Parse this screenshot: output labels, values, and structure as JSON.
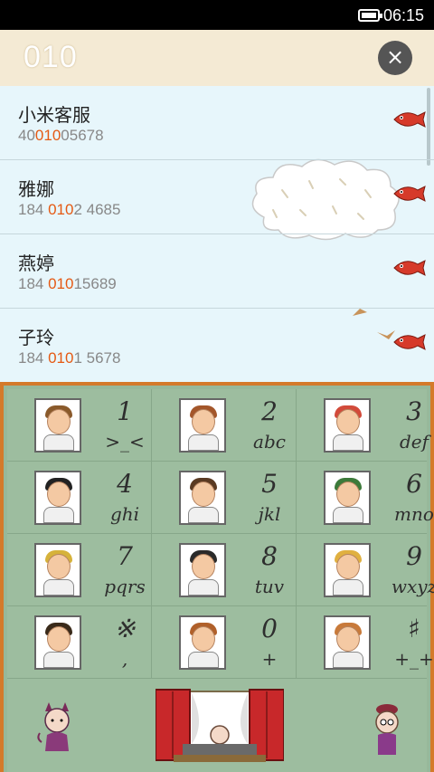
{
  "status_bar": {
    "time": "06:15"
  },
  "dialer": {
    "input_value": "010",
    "clear_icon": "close-circle-icon",
    "clear_label": "×"
  },
  "results": [
    {
      "name": "小米客服",
      "num_pre": "40",
      "num_hl": "010",
      "num_post": "05678"
    },
    {
      "name": "雅娜",
      "num_pre": "184 ",
      "num_hl": "010",
      "num_post": "2 4685"
    },
    {
      "name": "燕婷",
      "num_pre": "184 ",
      "num_hl": "010",
      "num_post": "15689"
    },
    {
      "name": "子玲",
      "num_pre": "184 ",
      "num_hl": "010",
      "num_post": "1 5678"
    }
  ],
  "keys": [
    {
      "digit": "1",
      "letters": ">_<"
    },
    {
      "digit": "2",
      "letters": "abc"
    },
    {
      "digit": "3",
      "letters": "def"
    },
    {
      "digit": "4",
      "letters": "ghi"
    },
    {
      "digit": "5",
      "letters": "jkl"
    },
    {
      "digit": "6",
      "letters": "mno"
    },
    {
      "digit": "7",
      "letters": "pqrs"
    },
    {
      "digit": "8",
      "letters": "tuv"
    },
    {
      "digit": "9",
      "letters": "wxyz"
    },
    {
      "digit": "※",
      "letters": ","
    },
    {
      "digit": "0",
      "letters": "+"
    },
    {
      "digit": "♯",
      "letters": "+_+"
    }
  ],
  "colors": {
    "highlight": "#e55a14",
    "list_bg": "#e7f6fb",
    "keypad_bg": "#9dbd9f",
    "keypad_border": "#d47a2a"
  }
}
